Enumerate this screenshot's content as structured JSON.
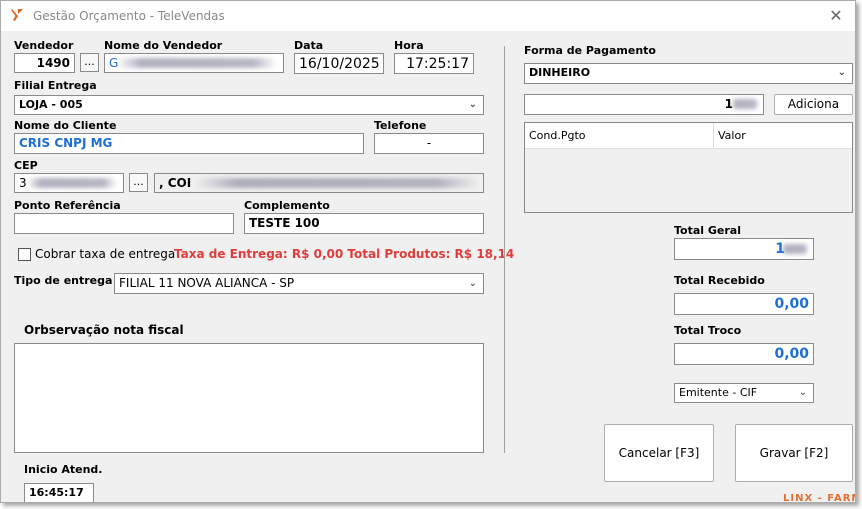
{
  "window": {
    "title": "Gestão Orçamento - TeleVendas",
    "close_symbol": "✕"
  },
  "vendedor": {
    "label": "Vendedor",
    "value": "1490",
    "lookup_label": "..."
  },
  "nome_vendedor": {
    "label": "Nome do Vendedor",
    "value": "G"
  },
  "data": {
    "label": "Data",
    "value": "16/10/2025"
  },
  "hora": {
    "label": "Hora",
    "value": "17:25:17"
  },
  "filial_entrega": {
    "label": "Filial Entrega",
    "value": "LOJA - 005"
  },
  "nome_cliente": {
    "label": "Nome do Cliente",
    "value": "CRIS CNPJ MG"
  },
  "telefone": {
    "label": "Telefone",
    "value": "-"
  },
  "cep": {
    "label": "CEP",
    "value": "3",
    "lookup_label": "...",
    "address": ", COI"
  },
  "ponto_referencia": {
    "label": "Ponto Referência",
    "value": ""
  },
  "complemento": {
    "label": "Complemento",
    "value": "TESTE 100"
  },
  "cobrar_taxa": {
    "label": "Cobrar taxa de entrega",
    "checked": false
  },
  "totals_text": "Taxa de Entrega: R$ 0,00 Total Produtos: R$ 18,14",
  "tipo_entrega": {
    "label": "Tipo de entrega",
    "value": "FILIAL 11 NOVA ALIANCA - SP"
  },
  "observacao": {
    "label": "Orbservação nota fiscal",
    "value": ""
  },
  "inicio_atend": {
    "label": "Inicio Atend.",
    "value": "16:45:17"
  },
  "pagamento": {
    "label": "Forma de Pagamento",
    "value": "DINHEIRO",
    "amount": "1",
    "add_label": "Adiciona",
    "columns": [
      "Cond.Pgto",
      "Valor"
    ]
  },
  "total_geral": {
    "label": "Total Geral",
    "value": "1"
  },
  "total_recebido": {
    "label": "Total Recebido",
    "value": "0,00"
  },
  "total_troco": {
    "label": "Total Troco",
    "value": "0,00"
  },
  "frete": {
    "value": "Emitente - CIF"
  },
  "buttons": {
    "cancel": "Cancelar [F3]",
    "save": "Gravar [F2]"
  },
  "footer": "LINX - FARM",
  "colors": {
    "accent_blue": "#1d6fd6",
    "alert_red": "#e03c3c",
    "logo_orange": "#e07030"
  }
}
